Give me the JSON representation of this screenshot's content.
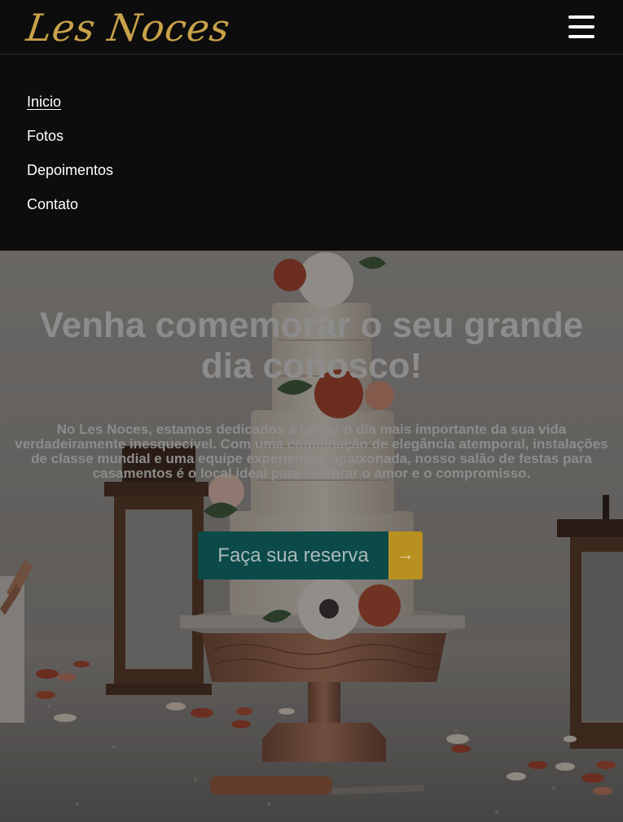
{
  "header": {
    "logo": "Les Noces",
    "menu_icon": "hamburger-menu-icon"
  },
  "nav": {
    "items": [
      {
        "label": "Inicio",
        "active": true
      },
      {
        "label": "Fotos",
        "active": false
      },
      {
        "label": "Depoimentos",
        "active": false
      },
      {
        "label": "Contato",
        "active": false
      }
    ]
  },
  "hero": {
    "title": "Venha comemorar o seu grande dia conosco!",
    "text": "No Les Noces, estamos dedicados a tornar o dia mais importante da sua vida verdadeiramente inesquecível. Com uma combinação de elegância atemporal, instalações de classe mundial e uma equipe experiente e apaixonada, nosso salão de festas para casamentos é o local ideal para celebrar o amor e o compromisso.",
    "cta_label": "Faça sua reserva",
    "cta_icon": "arrow-right-icon"
  },
  "colors": {
    "background": "#0d0d0d",
    "logo_gold": "#c9a24a",
    "cta_teal": "#0b4a48",
    "cta_gold": "#b8901f",
    "hero_text": "#8c8c8c"
  }
}
